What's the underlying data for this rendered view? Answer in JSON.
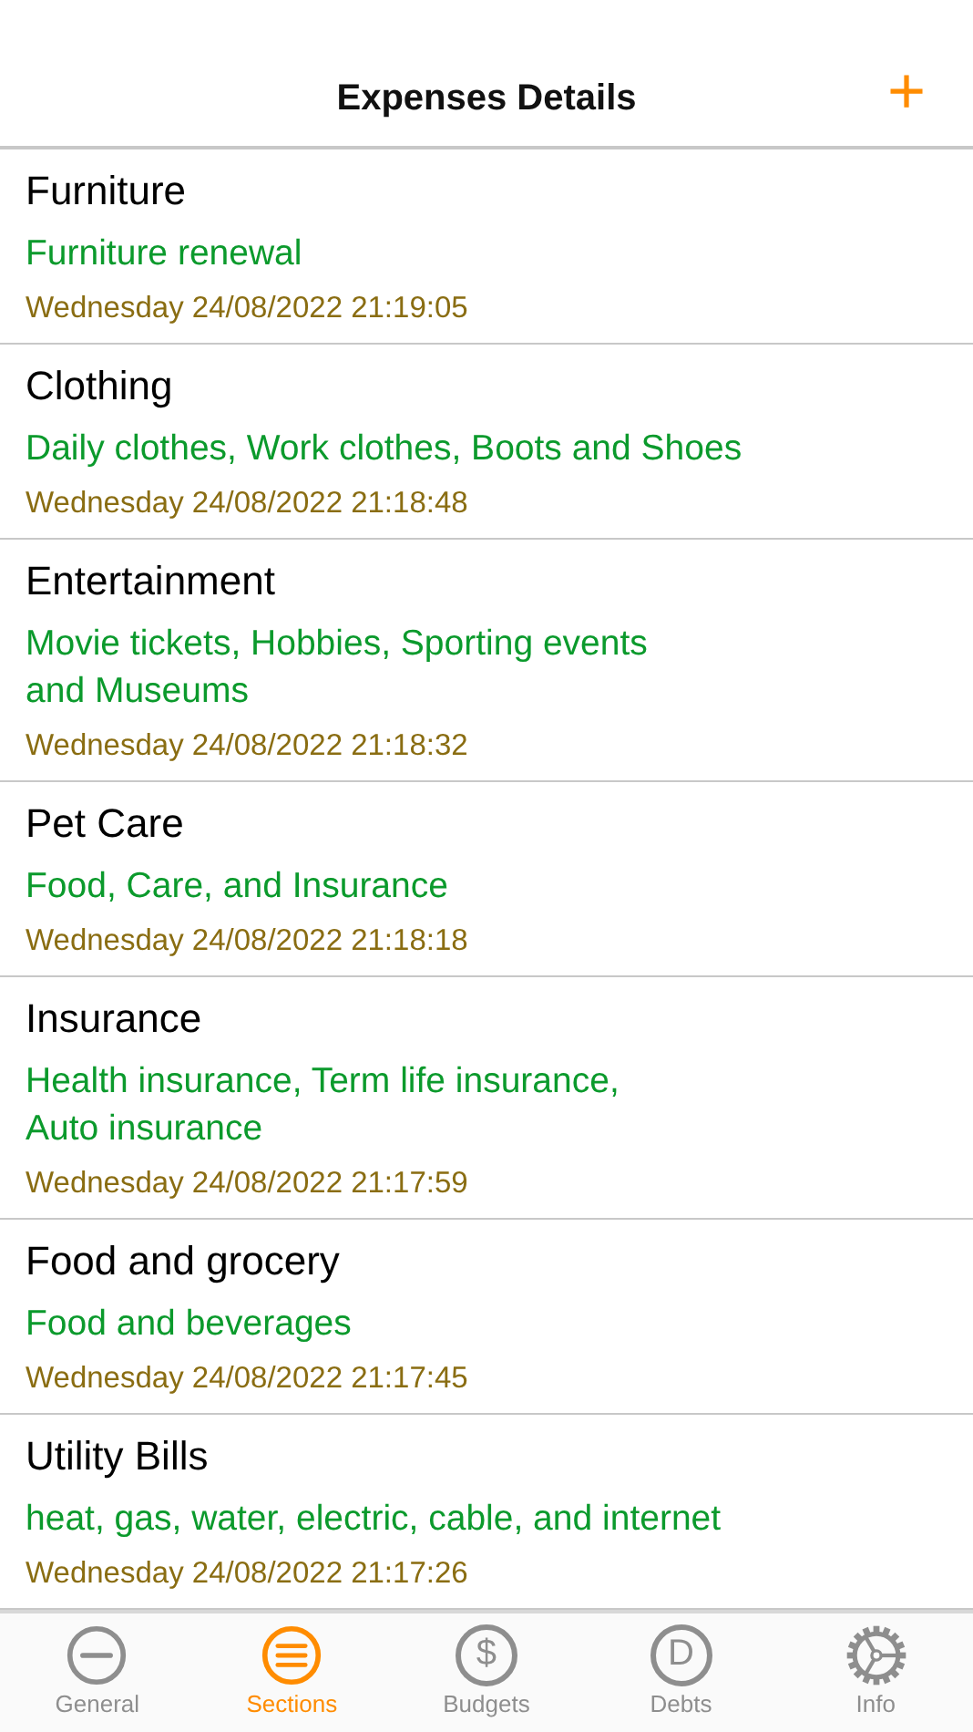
{
  "header": {
    "title": "Expenses Details",
    "add_button": "+"
  },
  "expenses": [
    {
      "name": "Furniture",
      "description": [
        "Furniture renewal"
      ],
      "date": "Wednesday 24/08/2022 21:19:05"
    },
    {
      "name": "Clothing",
      "description": [
        "Daily clothes, Work clothes, Boots and Shoes"
      ],
      "date": "Wednesday 24/08/2022 21:18:48"
    },
    {
      "name": "Entertainment",
      "description": [
        "Movie tickets, Hobbies, Sporting events",
        "and Museums"
      ],
      "date": "Wednesday 24/08/2022 21:18:32"
    },
    {
      "name": "Pet Care",
      "description": [
        "Food, Care, and Insurance"
      ],
      "date": "Wednesday 24/08/2022 21:18:18"
    },
    {
      "name": "Insurance",
      "description": [
        "Health insurance, Term life insurance,",
        "Auto insurance"
      ],
      "date": "Wednesday 24/08/2022 21:17:59"
    },
    {
      "name": "Food and grocery",
      "description": [
        "Food and beverages"
      ],
      "date": "Wednesday 24/08/2022 21:17:45"
    },
    {
      "name": "Utility Bills",
      "description": [
        "heat, gas, water, electric, cable, and internet"
      ],
      "date": "Wednesday 24/08/2022 21:17:26"
    }
  ],
  "tabs": [
    {
      "label": "General",
      "kind": "minus",
      "selected": false
    },
    {
      "label": "Sections",
      "kind": "lines",
      "selected": true
    },
    {
      "label": "Budgets",
      "kind": "symbol",
      "symbol": "$",
      "selected": false
    },
    {
      "label": "Debts",
      "kind": "symbol",
      "symbol": "D",
      "selected": false
    },
    {
      "label": "Info",
      "kind": "gear",
      "selected": false
    }
  ]
}
